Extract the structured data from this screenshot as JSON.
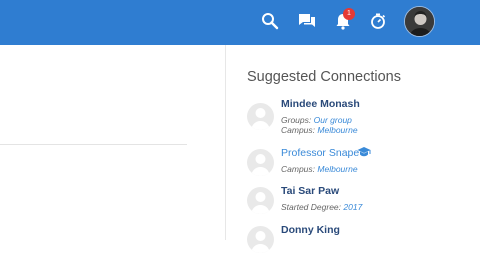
{
  "header": {
    "notification_count": "1",
    "icons": [
      "search-icon",
      "chat-icon",
      "bell-icon",
      "stopwatch-icon"
    ],
    "brand_color": "#2f7dd1"
  },
  "suggested": {
    "title": "Suggested Connections",
    "people": [
      {
        "name": "Mindee Monash",
        "groups_label": "Groups:",
        "groups_value": "Our group",
        "campus_label": "Campus:",
        "campus_value": "Melbourne"
      },
      {
        "name": "Professor Snape",
        "campus_label": "Campus:",
        "campus_value": "Melbourne"
      },
      {
        "name": "Tai Sar Paw",
        "degree_label": "Started Degree:",
        "degree_value": "2017"
      },
      {
        "name": "Donny King"
      }
    ]
  }
}
